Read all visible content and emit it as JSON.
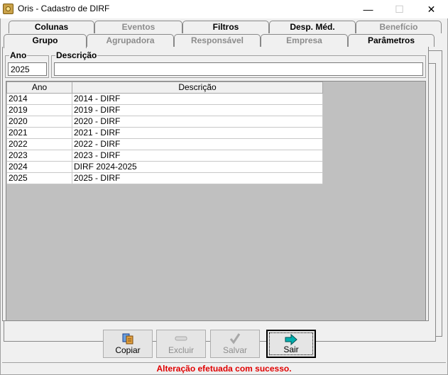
{
  "window": {
    "title": "Oris - Cadastro de DIRF",
    "minimize": "—",
    "maximize": "☐",
    "close": "✕"
  },
  "tabs_row1": [
    {
      "label": "Colunas",
      "enabled": true
    },
    {
      "label": "Eventos",
      "enabled": false
    },
    {
      "label": "Filtros",
      "enabled": true
    },
    {
      "label": "Desp. Méd.",
      "enabled": true
    },
    {
      "label": "Benefício",
      "enabled": false
    }
  ],
  "tabs_row2": [
    {
      "label": "Grupo",
      "enabled": true,
      "active": true
    },
    {
      "label": "Agrupadora",
      "enabled": false
    },
    {
      "label": "Responsável",
      "enabled": false
    },
    {
      "label": "Empresa",
      "enabled": false
    },
    {
      "label": "Parâmetros",
      "enabled": true
    }
  ],
  "form": {
    "ano_label": "Ano",
    "ano_value": "2025",
    "descricao_label": "Descrição",
    "descricao_value": ""
  },
  "grid": {
    "columns": [
      "Ano",
      "Descrição"
    ],
    "rows": [
      [
        "2014",
        "2014 - DIRF"
      ],
      [
        "2019",
        "2019 - DIRF"
      ],
      [
        "2020",
        "2020 - DIRF"
      ],
      [
        "2021",
        "2021 - DIRF"
      ],
      [
        "2022",
        "2022 - DIRF"
      ],
      [
        "2023",
        "2023 - DIRF"
      ],
      [
        "2024",
        "DIRF 2024-2025"
      ],
      [
        "2025",
        "2025 - DIRF"
      ]
    ]
  },
  "buttons": {
    "copiar": "Copiar",
    "excluir": "Excluir",
    "salvar": "Salvar",
    "sair": "Sair"
  },
  "status_message": "Alteração efetuada com sucesso.",
  "colors": {
    "status": "#e00000",
    "arrow": "#00a8a8"
  }
}
